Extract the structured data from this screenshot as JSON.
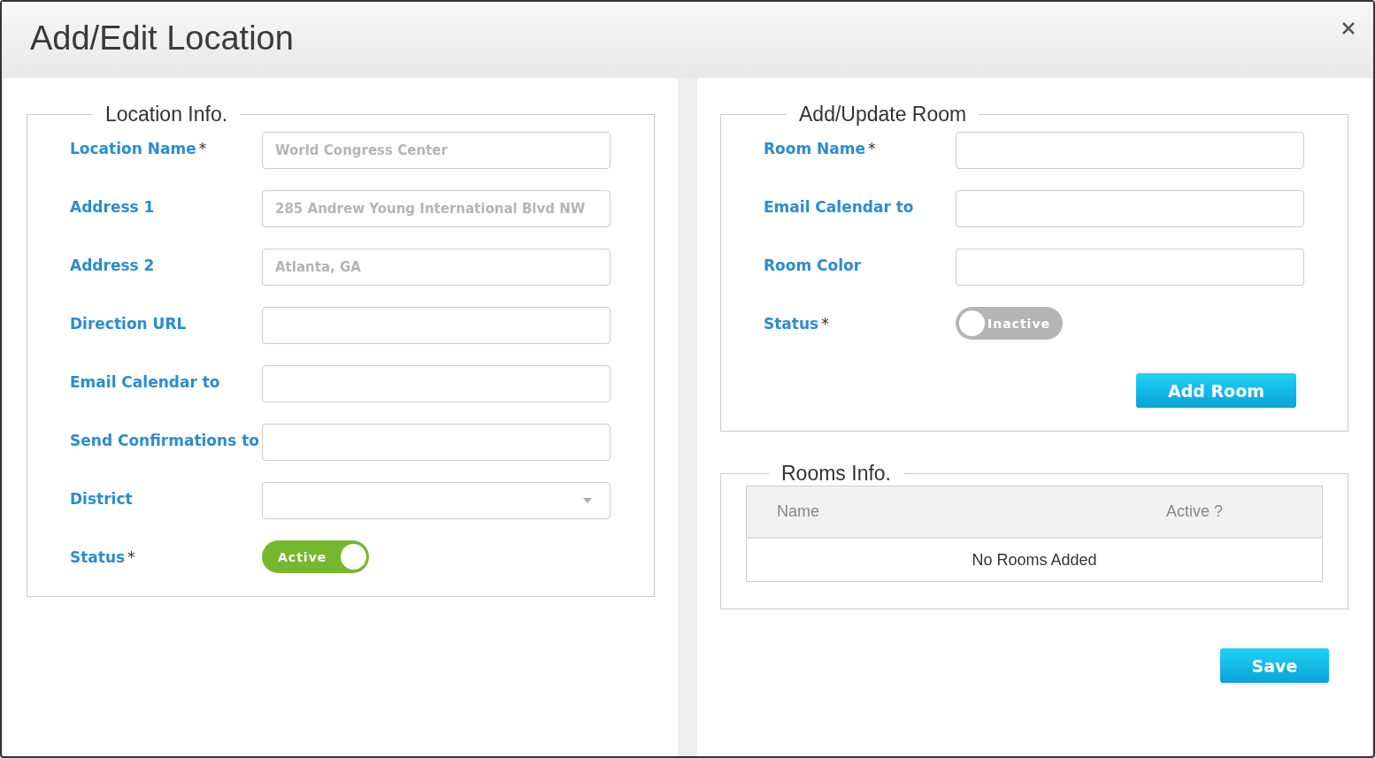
{
  "dialog": {
    "title": "Add/Edit Location"
  },
  "location_info": {
    "legend": "Location Info.",
    "fields": [
      {
        "kind": "text",
        "label": "Location Name",
        "mark": "*",
        "placeholder": "World Congress Center"
      },
      {
        "kind": "text",
        "label": "Address 1",
        "placeholder": "285 Andrew Young International Blvd NW"
      },
      {
        "kind": "text",
        "label": "Address 2",
        "placeholder": "Atlanta, GA"
      },
      {
        "kind": "text",
        "label": "Direction URL"
      },
      {
        "kind": "text",
        "label": "Email Calendar to"
      },
      {
        "kind": "text",
        "label": "Send Confirmations to"
      },
      {
        "kind": "select",
        "label": "District"
      },
      {
        "kind": "toggle",
        "label": "Status",
        "mark": "*",
        "on": true,
        "text": "Active"
      }
    ]
  },
  "room": {
    "legend": "Add/Update Room",
    "fields": [
      {
        "kind": "text",
        "label": "Room Name",
        "mark": "*"
      },
      {
        "kind": "text",
        "label": "Email Calendar to"
      },
      {
        "kind": "text",
        "label": "Room Color"
      },
      {
        "kind": "toggle",
        "label": "Status",
        "mark": "*",
        "on": false,
        "text": "Inactive"
      }
    ],
    "button": "Add Room"
  },
  "rooms_info": {
    "legend": "Rooms Info.",
    "table": {
      "columns": [
        "Name",
        "Active ?"
      ],
      "empty_text": "No Rooms Added"
    }
  },
  "save_button": "Save"
}
